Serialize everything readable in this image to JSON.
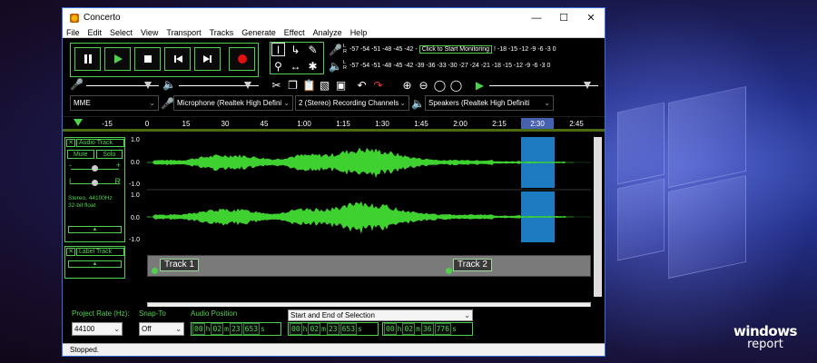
{
  "window": {
    "title": "Concerto"
  },
  "menu": [
    "File",
    "Edit",
    "Select",
    "View",
    "Transport",
    "Tracks",
    "Generate",
    "Effect",
    "Analyze",
    "Help"
  ],
  "transport": [
    "pause",
    "play",
    "stop",
    "skip-to-start",
    "skip-to-end",
    "record"
  ],
  "meters": {
    "record_scale_left": "-57 -54 -51 -48 -45 -42 -",
    "monitor_label": "Click to Start Monitoring",
    "record_scale_right": "! -18 -15 -12 -9 -6 -3 0",
    "playback_scale": "-57 -54 -51 -48 -45 -42 -39 -36 -33 -30 -27 -24 -21 -18 -15 -12 -9 -6 -3 0",
    "l": "L",
    "r": "R"
  },
  "devices": {
    "host": "MME",
    "input": "Microphone (Realtek High Defini",
    "channels": "2 (Stereo) Recording Channels",
    "output": "Speakers (Realtek High Definiti"
  },
  "timeline_ticks": [
    "-15",
    "0",
    "15",
    "30",
    "45",
    "1:00",
    "1:15",
    "1:30",
    "1:45",
    "2:00",
    "2:15",
    "2:30",
    "2:45"
  ],
  "audio_track": {
    "name": "Audio Track",
    "mute": "Mute",
    "solo": "Solo",
    "gain_min": "-",
    "gain_max": "+",
    "pan_left": "L",
    "pan_right": "R",
    "info_line1": "Stereo, 44100Hz",
    "info_line2": "32-bit float",
    "scale_top": "1.0",
    "scale_mid": "0.0",
    "scale_bot": "-1.0"
  },
  "label_track": {
    "name": "Label Track",
    "labels": [
      "Track 1",
      "Track 2"
    ]
  },
  "bottom": {
    "project_rate_label": "Project Rate (Hz):",
    "project_rate": "44100",
    "snap_to_label": "Snap-To",
    "snap_to": "Off",
    "audio_position_label": "Audio Position",
    "selection_mode": "Start and End of Selection",
    "audio_position": [
      "00",
      "h",
      "02",
      "m",
      "23",
      "653",
      "s"
    ],
    "selection_start": [
      "00",
      "h",
      "02",
      "m",
      "23",
      "653",
      "s"
    ],
    "selection_end": [
      "00",
      "h",
      "02",
      "m",
      "36",
      "776",
      "s"
    ]
  },
  "status": "Stopped.",
  "watermark": {
    "line1": "windows",
    "line2": "report"
  }
}
